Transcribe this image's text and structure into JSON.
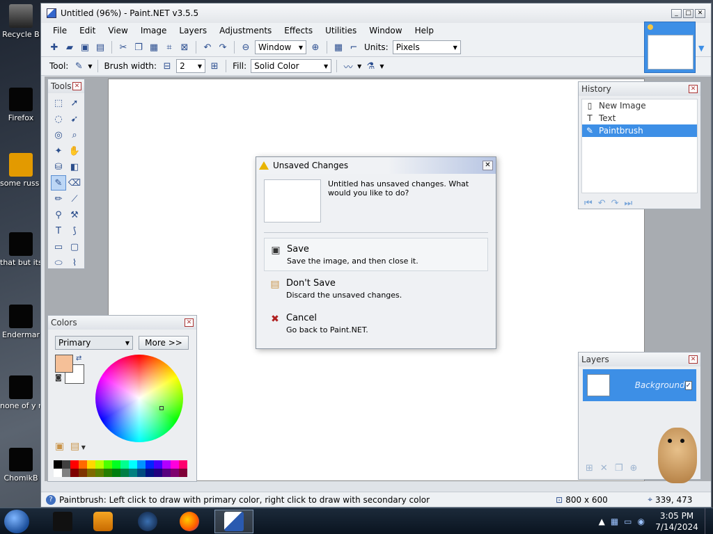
{
  "desktop_icons": [
    "Recycle B",
    "Firefox",
    "some russ ran a ra",
    "that but its",
    "Endermar",
    "none of y retards kn",
    "ChomikB"
  ],
  "window": {
    "title": "Untitled (96%) - Paint.NET v3.5.5",
    "controls": [
      "_",
      "□",
      "✕"
    ]
  },
  "menu": [
    "File",
    "Edit",
    "View",
    "Image",
    "Layers",
    "Adjustments",
    "Effects",
    "Utilities",
    "Window",
    "Help"
  ],
  "toolbar": {
    "zoom_value": "Window",
    "units_label": "Units:",
    "units_value": "Pixels",
    "tool_label": "Tool:",
    "brush_width_label": "Brush width:",
    "brush_width_value": "2",
    "fill_label": "Fill:",
    "fill_value": "Solid Color"
  },
  "tools_panel": {
    "title": "Tools"
  },
  "history_panel": {
    "title": "History",
    "items": [
      {
        "label": "New Image",
        "selected": false
      },
      {
        "label": "Text",
        "selected": false
      },
      {
        "label": "Paintbrush",
        "selected": true
      }
    ]
  },
  "layers_panel": {
    "title": "Layers",
    "layer_name": "Background"
  },
  "colors_panel": {
    "title": "Colors",
    "mode": "Primary",
    "more_button": "More >>",
    "primary_color": "#f5c098",
    "secondary_color": "#ffffff",
    "palette": [
      "#000000",
      "#404040",
      "#ff0000",
      "#ff6a00",
      "#ffd800",
      "#b6ff00",
      "#4cff00",
      "#00ff21",
      "#00ff90",
      "#00ffff",
      "#0094ff",
      "#0026ff",
      "#4800ff",
      "#b200ff",
      "#ff00dc",
      "#ff006e",
      "#ffffff",
      "#808080",
      "#7f0000",
      "#7f3300",
      "#7f6a00",
      "#5b7f00",
      "#267f00",
      "#007f0e",
      "#007f46",
      "#007f7f",
      "#004a7f",
      "#00137f",
      "#21007f",
      "#57007f",
      "#7f006e",
      "#7f0037"
    ]
  },
  "dialog": {
    "title": "Unsaved Changes",
    "message": "Untitled has unsaved changes. What would you like to do?",
    "options": [
      {
        "title": "Save",
        "desc": "Save the image, and then close it."
      },
      {
        "title": "Don't Save",
        "desc": "Discard the unsaved changes."
      },
      {
        "title": "Cancel",
        "desc": "Go back to Paint.NET."
      }
    ]
  },
  "status": {
    "hint": "Paintbrush: Left click to draw with primary color, right click to draw with secondary color",
    "image_size": "800 x 600",
    "cursor_pos": "339, 473"
  },
  "taskbar": {
    "time": "3:05 PM",
    "date": "7/14/2024"
  }
}
